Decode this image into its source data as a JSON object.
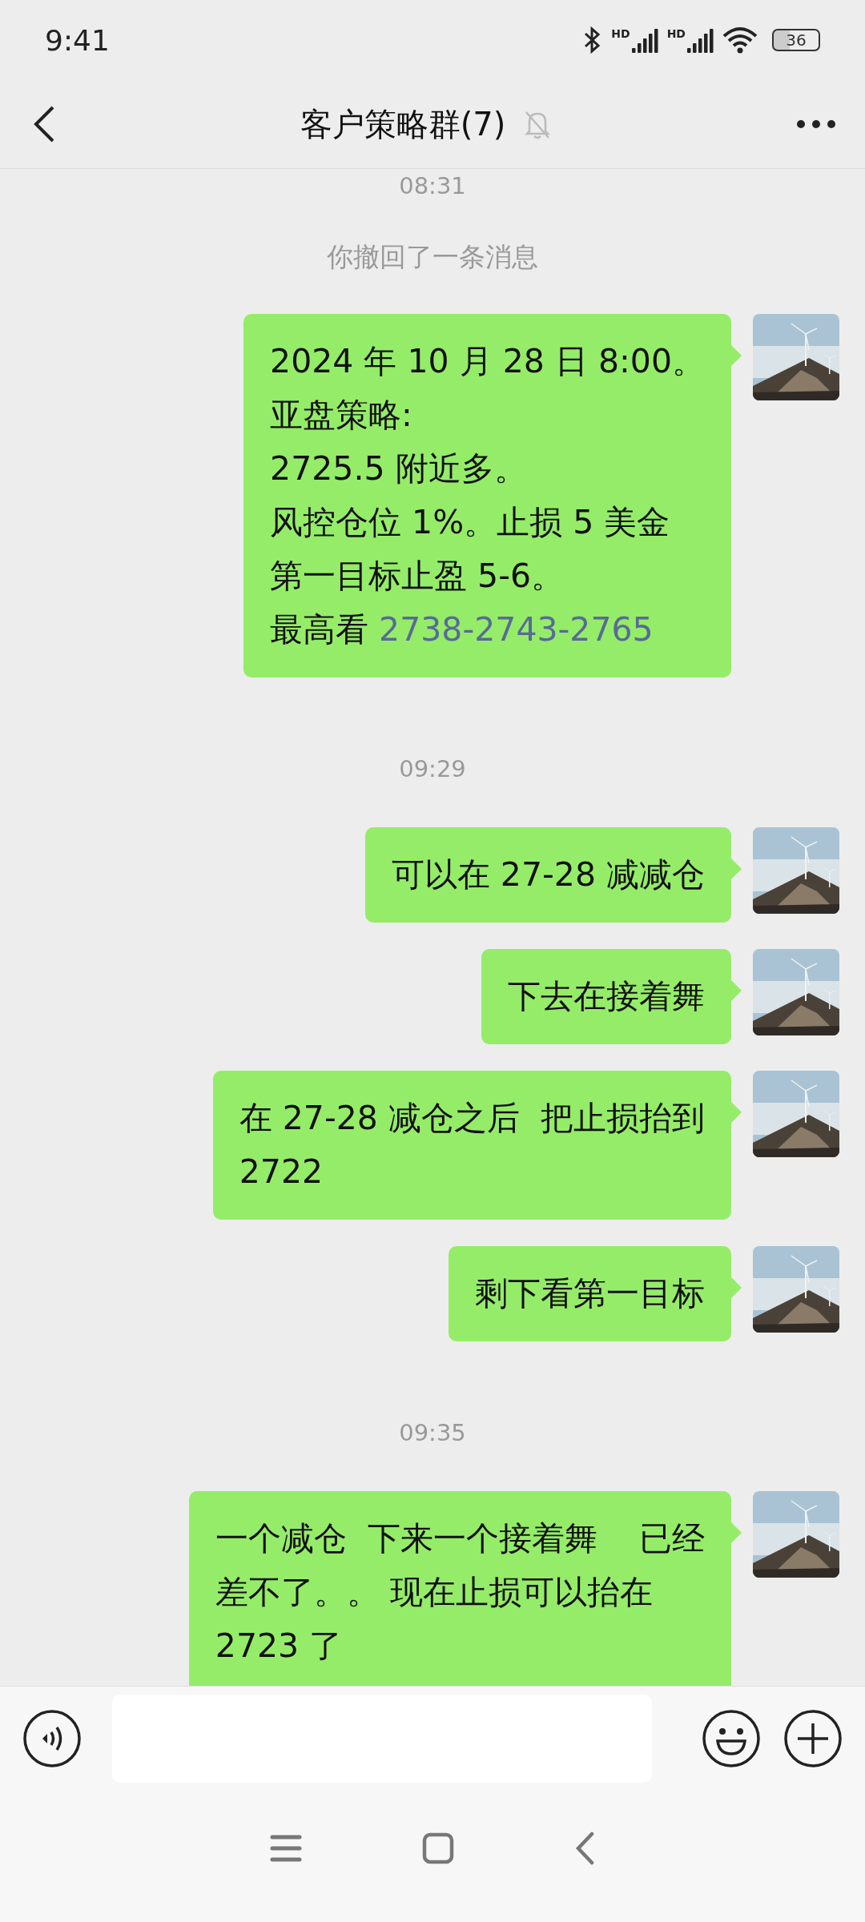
{
  "status_bar": {
    "time": "9:41",
    "signals": [
      "HD",
      "HD"
    ],
    "battery": "36"
  },
  "header": {
    "title": "客户策略群(7)",
    "muted": true
  },
  "messages": [
    {
      "kind": "time",
      "text": "08:31"
    },
    {
      "kind": "system",
      "text": "你撤回了一条消息"
    },
    {
      "kind": "message",
      "lines": [
        "2024 年 10 月 28 日 8:00。",
        "亚盘策略:",
        "2725.5 附近多。",
        "风控仓位 1%。止损 5 美金",
        "第一目标止盈 5-6。",
        "最高看 "
      ],
      "link": "2738-2743-2765"
    },
    {
      "kind": "time",
      "text": "09:29"
    },
    {
      "kind": "message",
      "lines": [
        "可以在 27-28 减减仓"
      ]
    },
    {
      "kind": "message",
      "lines": [
        "下去在接着舞"
      ]
    },
    {
      "kind": "message",
      "lines": [
        "在 27-28 减仓之后  把止损抬到",
        "2722"
      ]
    },
    {
      "kind": "message",
      "lines": [
        "剩下看第一目标"
      ]
    },
    {
      "kind": "time",
      "text": "09:35"
    },
    {
      "kind": "message",
      "lines": [
        "一个减仓  下来一个接着舞    已经",
        "差不了。。 现在止损可以抬在",
        "2723 了"
      ]
    }
  ]
}
